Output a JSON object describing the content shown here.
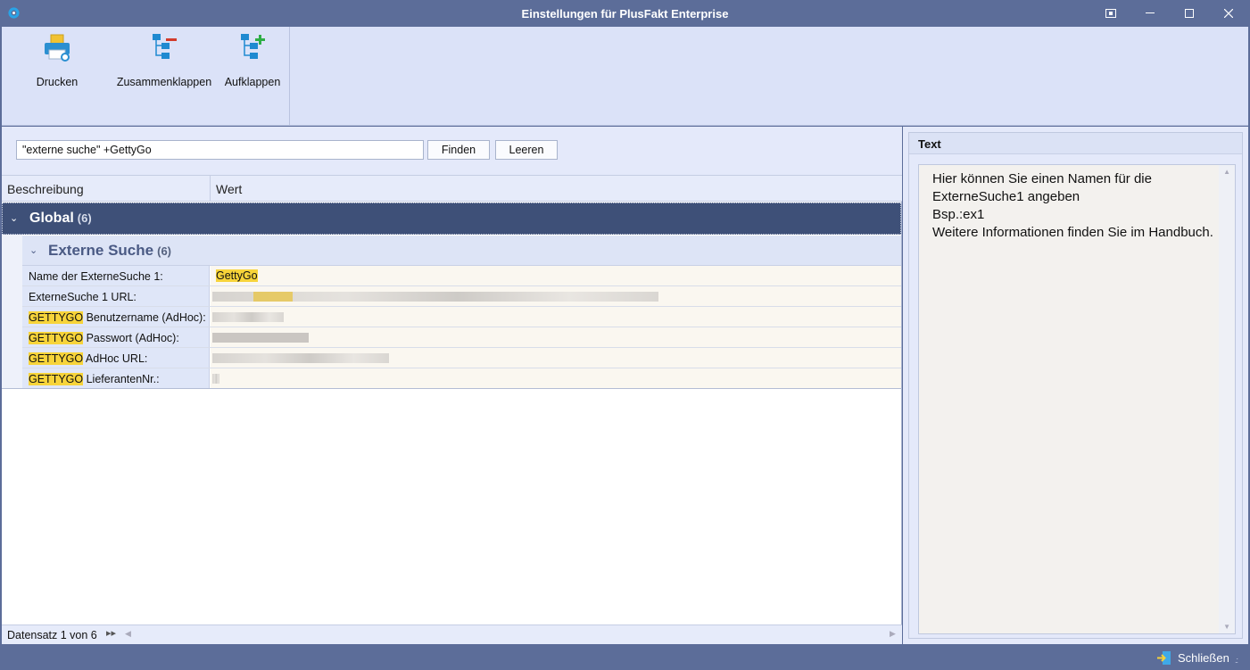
{
  "window": {
    "title": "Einstellungen für PlusFakt Enterprise"
  },
  "ribbon": {
    "print_label": "Drucken",
    "collapse_label": "Zusammenklappen",
    "expand_label": "Aufklappen"
  },
  "search": {
    "value": "\"externe suche\" +GettyGo",
    "find_label": "Finden",
    "clear_label": "Leeren"
  },
  "grid": {
    "col_desc": "Beschreibung",
    "col_value": "Wert",
    "group": {
      "label": "Global",
      "count": "(6)"
    },
    "subgroup": {
      "label": "Externe Suche",
      "count": "(6)"
    },
    "rows": [
      {
        "hl": "",
        "label": "Name der ExterneSuche 1:",
        "value": "GettyGo"
      },
      {
        "hl": "",
        "label": "ExterneSuche 1 URL:"
      },
      {
        "hl": "GETTYGO",
        "label": " Benutzername (AdHoc):"
      },
      {
        "hl": "GETTYGO",
        "label": " Passwort (AdHoc):"
      },
      {
        "hl": "GETTYGO",
        "label": " AdHoc URL:"
      },
      {
        "hl": "GETTYGO",
        "label": " LieferantenNr.:"
      }
    ]
  },
  "status": {
    "record": "Datensatz 1 von 6"
  },
  "textpanel": {
    "title": "Text",
    "body": "Hier können Sie einen Namen für die ExterneSuche1 angeben\nBsp.:ex1\nWeitere Informationen finden Sie im Handbuch."
  },
  "footer": {
    "close_label": "Schließen"
  }
}
